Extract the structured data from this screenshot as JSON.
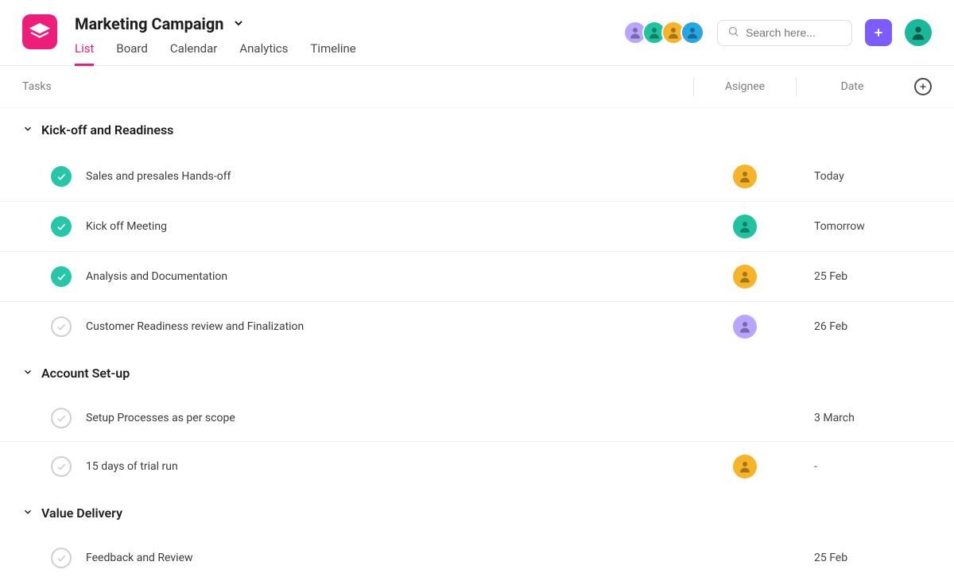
{
  "header": {
    "title": "Marketing Campaign",
    "tabs": [
      "List",
      "Board",
      "Calendar",
      "Analytics",
      "Timeline"
    ],
    "active_tab": 0,
    "search_placeholder": "Search here...",
    "members": [
      {
        "color": "av-purple"
      },
      {
        "color": "av-green"
      },
      {
        "color": "av-gold"
      },
      {
        "color": "av-cyan"
      }
    ]
  },
  "columns": {
    "tasks": "Tasks",
    "assignee": "Asignee",
    "date": "Date"
  },
  "sections": [
    {
      "name": "Kick-off and Readiness",
      "tasks": [
        {
          "title": "Sales and presales Hands-off",
          "done": true,
          "assignee": "av-gold",
          "date": "Today"
        },
        {
          "title": "Kick off Meeting",
          "done": true,
          "assignee": "av-green",
          "date": "Tomorrow"
        },
        {
          "title": "Analysis and Documentation",
          "done": true,
          "assignee": "av-gold",
          "date": "25 Feb"
        },
        {
          "title": "Customer Readiness review and Finalization",
          "done": false,
          "assignee": "av-purple",
          "date": "26 Feb"
        }
      ]
    },
    {
      "name": "Account Set-up",
      "tasks": [
        {
          "title": "Setup Processes as per scope",
          "done": false,
          "assignee": null,
          "date": "3 March"
        },
        {
          "title": "15 days of trial run",
          "done": false,
          "assignee": "av-gold",
          "date": "-"
        }
      ]
    },
    {
      "name": "Value Delivery",
      "tasks": [
        {
          "title": "Feedback and Review",
          "done": false,
          "assignee": null,
          "date": "25 Feb"
        }
      ]
    }
  ]
}
